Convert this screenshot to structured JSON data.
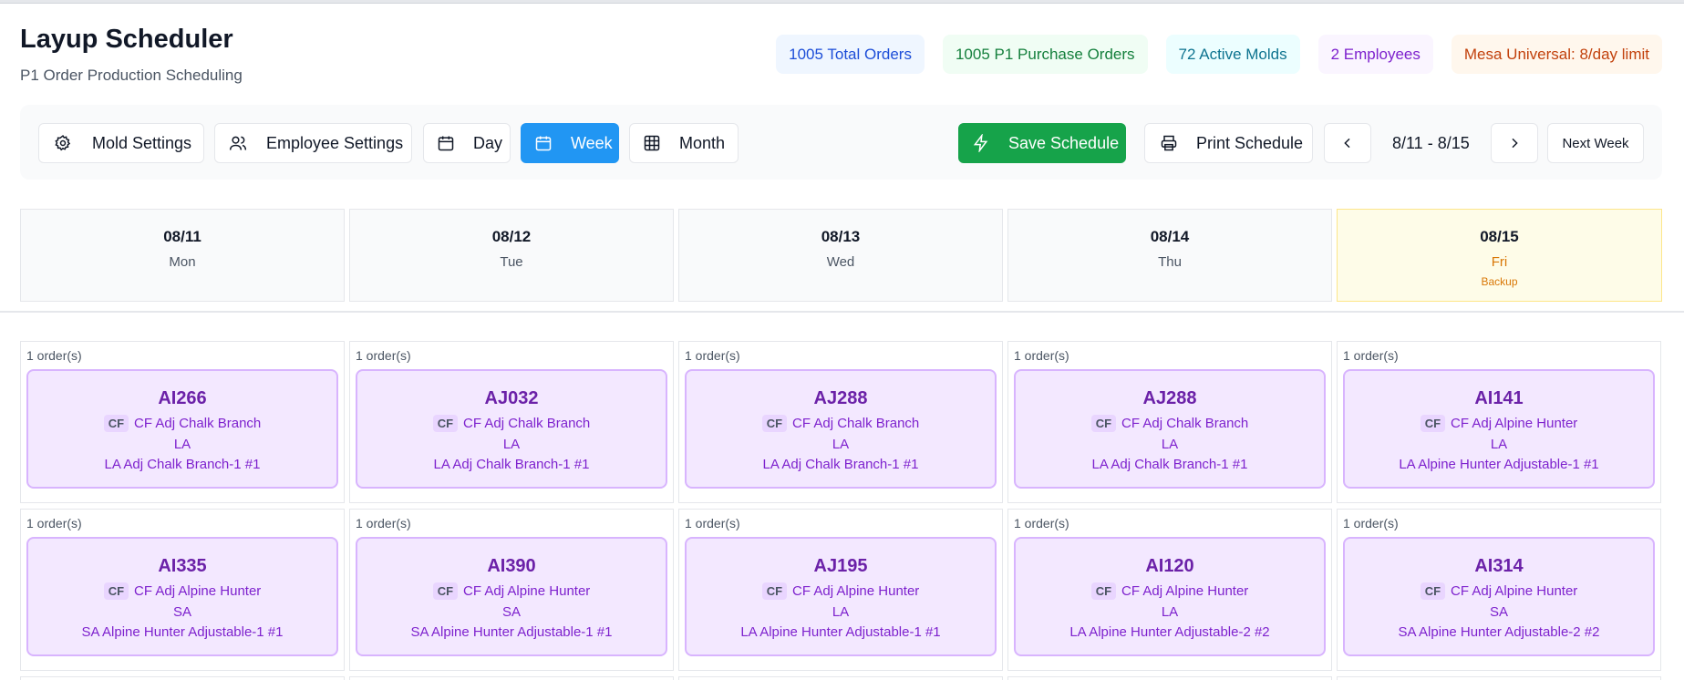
{
  "app": {
    "title": "Layup Scheduler",
    "subtitle": "P1 Order Production Scheduling"
  },
  "stats": [
    {
      "label": "1005 Total Orders",
      "bg": "#eff6ff",
      "fg": "#1d4ed8"
    },
    {
      "label": "1005 P1 Purchase Orders",
      "bg": "#f0fdf4",
      "fg": "#15803d"
    },
    {
      "label": "72 Active Molds",
      "bg": "#ecfeff",
      "fg": "#0e7490"
    },
    {
      "label": "2 Employees",
      "bg": "#faf5ff",
      "fg": "#7e22ce"
    },
    {
      "label": "Mesa Universal: 8/day limit",
      "bg": "#fff7ed",
      "fg": "#c2410c"
    }
  ],
  "toolbar": {
    "mold_settings": "Mold Settings",
    "employee_settings": "Employee Settings",
    "day": "Day",
    "week": "Week",
    "month": "Month",
    "active_view": "Week",
    "save_schedule": "Save Schedule",
    "print_schedule": "Print Schedule",
    "date_range": "8/11 - 8/15",
    "next_week": "Next Week"
  },
  "days": [
    {
      "date": "08/11",
      "dow": "Mon",
      "tag": ""
    },
    {
      "date": "08/12",
      "dow": "Tue",
      "tag": ""
    },
    {
      "date": "08/13",
      "dow": "Wed",
      "tag": ""
    },
    {
      "date": "08/14",
      "dow": "Thu",
      "tag": ""
    },
    {
      "date": "08/15",
      "dow": "Fri",
      "tag": "Backup"
    }
  ],
  "rows": [
    [
      {
        "count": "1 order(s)",
        "order": "AI266",
        "cf": "CF",
        "stock": "CF Adj Chalk Branch",
        "hand": "LA",
        "mold": "LA Adj Chalk Branch-1 #1"
      },
      {
        "count": "1 order(s)",
        "order": "AJ032",
        "cf": "CF",
        "stock": "CF Adj Chalk Branch",
        "hand": "LA",
        "mold": "LA Adj Chalk Branch-1 #1"
      },
      {
        "count": "1 order(s)",
        "order": "AJ288",
        "cf": "CF",
        "stock": "CF Adj Chalk Branch",
        "hand": "LA",
        "mold": "LA Adj Chalk Branch-1 #1"
      },
      {
        "count": "1 order(s)",
        "order": "AJ288",
        "cf": "CF",
        "stock": "CF Adj Chalk Branch",
        "hand": "LA",
        "mold": "LA Adj Chalk Branch-1 #1"
      },
      {
        "count": "1 order(s)",
        "order": "AI141",
        "cf": "CF",
        "stock": "CF Adj Alpine Hunter",
        "hand": "LA",
        "mold": "LA Alpine Hunter Adjustable-1 #1"
      }
    ],
    [
      {
        "count": "1 order(s)",
        "order": "AI335",
        "cf": "CF",
        "stock": "CF Adj Alpine Hunter",
        "hand": "SA",
        "mold": "SA Alpine Hunter Adjustable-1 #1"
      },
      {
        "count": "1 order(s)",
        "order": "AI390",
        "cf": "CF",
        "stock": "CF Adj Alpine Hunter",
        "hand": "SA",
        "mold": "SA Alpine Hunter Adjustable-1 #1"
      },
      {
        "count": "1 order(s)",
        "order": "AJ195",
        "cf": "CF",
        "stock": "CF Adj Alpine Hunter",
        "hand": "LA",
        "mold": "LA Alpine Hunter Adjustable-1 #1"
      },
      {
        "count": "1 order(s)",
        "order": "AI120",
        "cf": "CF",
        "stock": "CF Adj Alpine Hunter",
        "hand": "LA",
        "mold": "LA Alpine Hunter Adjustable-2 #2"
      },
      {
        "count": "1 order(s)",
        "order": "AI314",
        "cf": "CF",
        "stock": "CF Adj Alpine Hunter",
        "hand": "SA",
        "mold": "SA Alpine Hunter Adjustable-2 #2"
      }
    ]
  ]
}
